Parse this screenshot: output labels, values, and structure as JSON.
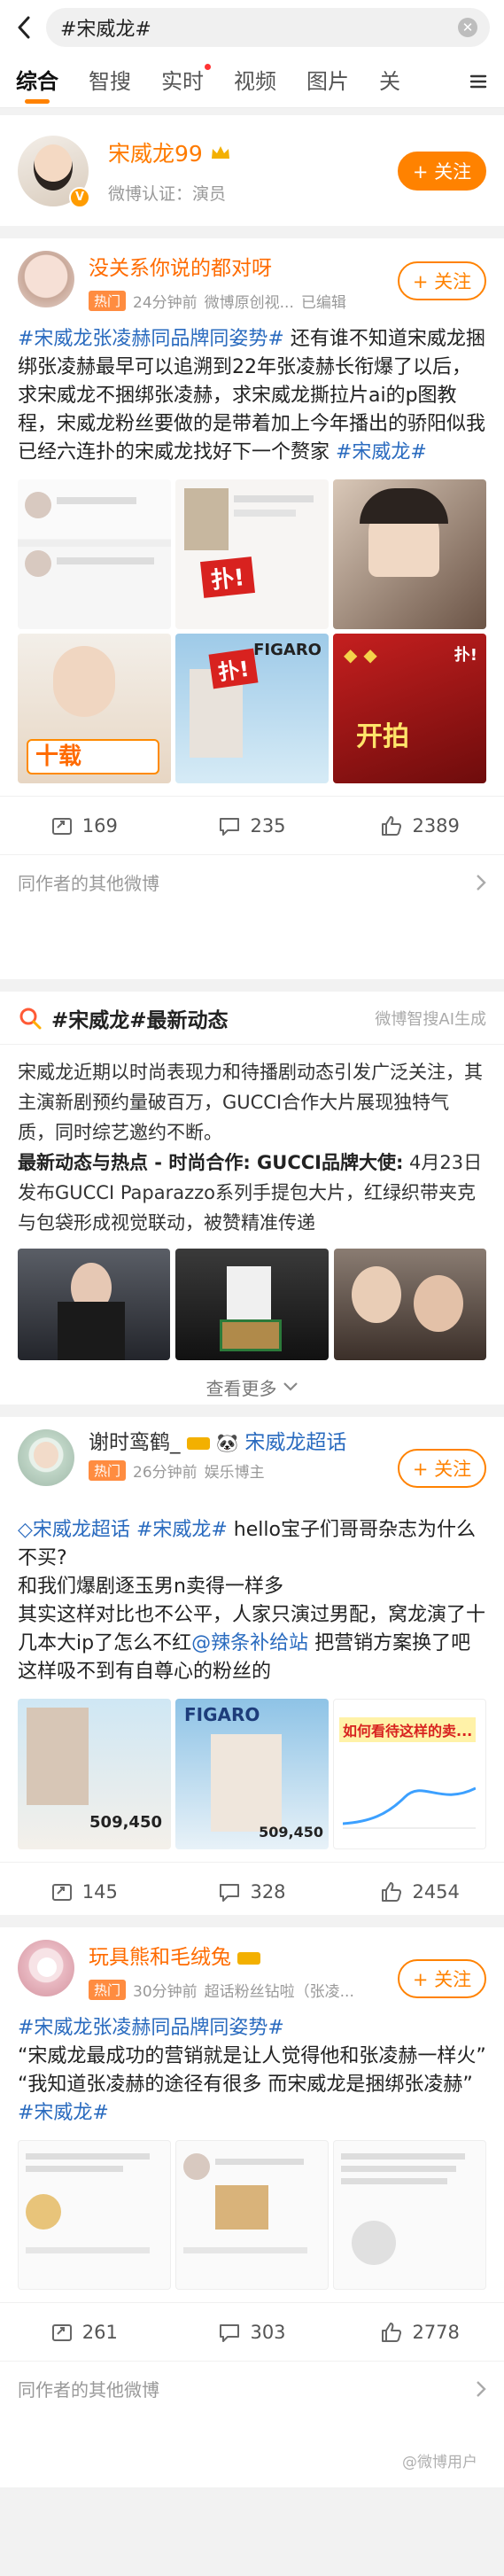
{
  "search": {
    "query": "#宋威龙#"
  },
  "tabs": [
    {
      "label": "综合",
      "active": true
    },
    {
      "label": "智搜"
    },
    {
      "label": "实时",
      "dot": true
    },
    {
      "label": "视频"
    },
    {
      "label": "图片"
    },
    {
      "label": "关"
    }
  ],
  "user_card": {
    "name": "宋威龙99",
    "cert": "微博认证：演员",
    "follow_label": "+ 关注"
  },
  "post1": {
    "name": "没关系你说的都对呀",
    "hot": "热门",
    "time": "24分钟前",
    "source": "微博原创视...",
    "edited": "已编辑",
    "follow_label": "+ 关注",
    "text": [
      {
        "t": "#宋威龙张凌赫同品牌同姿势#",
        "tag": true
      },
      {
        "t": " 还有谁不知道宋威龙捆绑张凌赫最早可以追溯到22年张凌赫长衔爆了以后，求宋威龙不捆绑张凌赫，求宋威龙撕拉片ai的p图教程，宋威龙粉丝要做的是带着加上今年播出的骄阳似我已经六连扑的宋威龙找好下一个赘家 "
      },
      {
        "t": "#宋威龙#",
        "tag": true
      }
    ],
    "thumb_overlays": [
      "扑!",
      "扑!",
      "FIGARO",
      "十载",
      "开拍",
      "扑!"
    ],
    "reposts": "169",
    "comments": "235",
    "likes": "2389"
  },
  "more_author_1": "同作者的其他微博",
  "ai_card": {
    "title": "#宋威龙#最新动态",
    "source": "微博智搜AI生成",
    "para1": "宋威龙近期以时尚表现力和待播剧动态引发广泛关注，其主演新剧预约量破百万，GUCCI合作大片展现独特气质，同时综艺邀约不断。",
    "subhead": "最新动态与热点 - 时尚合作: GUCCI品牌大使:",
    "para2": " 4月23日发布GUCCI Paparazzo系列手提包大片，红绿织带夹克与包袋形成视觉联动，被赞精准传递",
    "see_more": "查看更多"
  },
  "post2": {
    "name": "谢时鸾鹤_",
    "super_tag": "宋威龙超话",
    "hot": "热门",
    "time": "26分钟前",
    "source": "娱乐博主",
    "follow_label": "+ 关注",
    "line1_tag1": "宋威龙超话",
    "line1_tag2": "#宋威龙#",
    "line1_text": " hello宝子们哥哥杂志为什么不买?",
    "line2": "和我们爆剧逐玉男n卖得一样多",
    "line3a": "其实这样对比也不公平，人家只演过男配，窝龙演了十几本大ip了怎么不红",
    "mention": "@辣条补给站",
    "line3b": " 把营销方案换了吧这样吸不到有自尊心的粉丝的",
    "thumb_overlays": [
      "509,450",
      "FIGARO",
      "509,450",
      "如何看待这样的卖..."
    ],
    "reposts": "145",
    "comments": "328",
    "likes": "2454"
  },
  "post3": {
    "name": "玩具熊和毛绒兔",
    "hot": "热门",
    "time": "30分钟前",
    "source": "超话粉丝钻啦（张凌...",
    "follow_label": "+ 关注",
    "tag_line": "#宋威龙张凌赫同品牌同姿势#",
    "q1": "“宋威龙最成功的营销就是让人觉得他和张凌赫一样火”",
    "q2": "“我知道张凌赫的途径有很多 而宋威龙是捆绑张凌赫”",
    "tag_end": "#宋威龙#",
    "reposts": "261",
    "comments": "303",
    "likes": "2778"
  },
  "more_author_2": "同作者的其他微博",
  "watermark": "@微博用户",
  "colors": {
    "accent": "#ff8200",
    "link": "#2a6bbf",
    "name": "#ff6b00"
  },
  "icons": [
    "back-icon",
    "clear-icon",
    "crown-icon",
    "verified-icon",
    "repost-icon",
    "comment-icon",
    "like-icon",
    "ai-icon",
    "chevron-right-icon"
  ]
}
